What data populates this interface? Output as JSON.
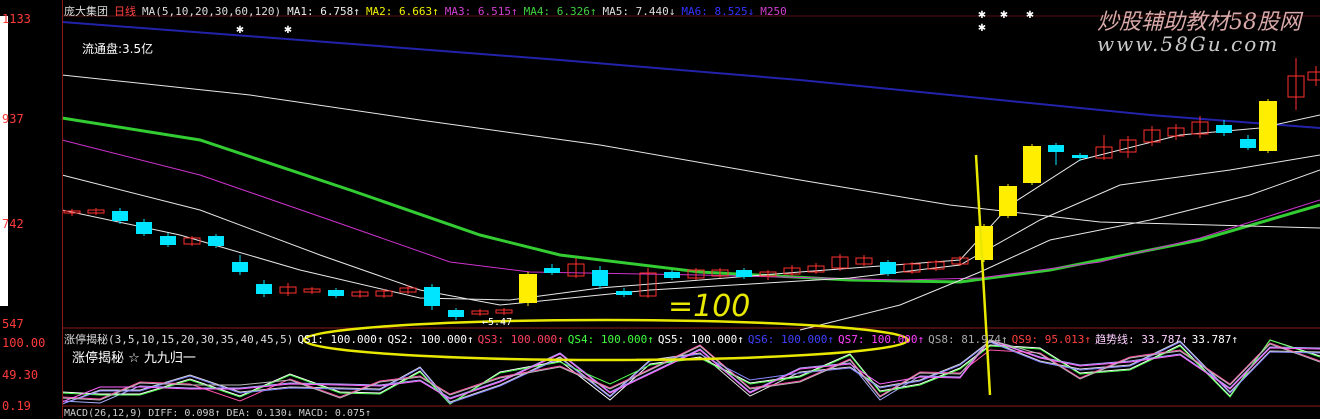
{
  "stock": {
    "name": "庞大集团",
    "period": "日线"
  },
  "header": {
    "ma": "MA(5,10,20,30,60,120)",
    "ma1": "MA1: 6.758↑",
    "ma2": "MA2: 6.663↑",
    "ma3": "MA3: 6.515↑",
    "ma4": "MA4: 6.326↑",
    "ma5": "MA5: 7.440↓",
    "ma6": "MA6: 8.525↓",
    "m250": "M250"
  },
  "y_axis": {
    "p1133": "1133",
    "p937": "937",
    "p742": "742",
    "p547": "547"
  },
  "sub_axis": {
    "v100": "100.00",
    "v4930": "49.30",
    "v019": "0.19"
  },
  "float_cap": "流通盘:3.5亿",
  "low_label": "←5.47",
  "indicator": {
    "name": "涨停揭秘(3,5,10,15,20,30,35,40,45,5)",
    "qs1": "QS1: 100.000↑",
    "qs2": "QS2: 100.000↑",
    "qs3": "QS3: 100.000↑",
    "qs4": "QS4: 100.000↑",
    "qs5": "QS5: 100.000↑",
    "qs6": "QS6: 100.000↑",
    "qs7": "QS7: 100.000↑",
    "qs8": "QS8: 81.974↑",
    "qs9": "QS9: 95.013↑",
    "trend": "趋势线: 33.787↑",
    "trend2": "33.787↑",
    "sub_title": "涨停揭秘 ☆ 九九归一"
  },
  "macd": "MACD(26,12,9) DIFF: 0.098↑ DEA: 0.130↓ MACD: 0.075↑",
  "annotation": "=100",
  "watermark": {
    "line1": "炒股辅助教材58股网",
    "line2": "www.58Gu.com"
  },
  "colors": {
    "up": "#ff3030",
    "down": "#00e5ff",
    "limit": "#ffee00",
    "ma60": "#33cc33",
    "ma250": "#2222aa",
    "magenta": "#cc33cc",
    "yellowInk": "#e8e800"
  }
}
